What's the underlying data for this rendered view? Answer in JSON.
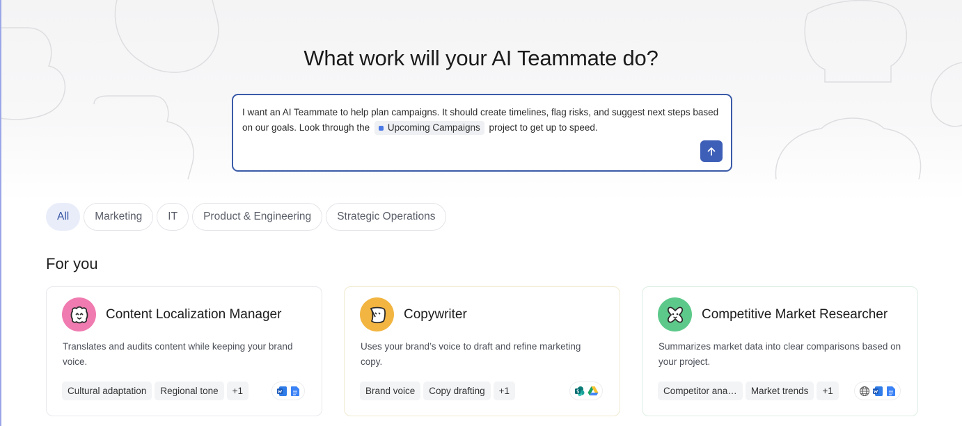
{
  "headline": "What work will your AI Teammate do?",
  "prompt": {
    "text_before": "I want an AI Teammate to help plan campaigns. It should create timelines, flag risks, and suggest next steps based on our goals. Look through the",
    "mention": "Upcoming Campaigns",
    "text_after": "project to get up to speed.",
    "send_icon": "arrow-up-icon"
  },
  "filters": [
    {
      "label": "All",
      "active": true
    },
    {
      "label": "Marketing",
      "active": false
    },
    {
      "label": "IT",
      "active": false
    },
    {
      "label": "Product & Engineering",
      "active": false
    },
    {
      "label": "Strategic Operations",
      "active": false
    }
  ],
  "section_title": "For you",
  "cards": [
    {
      "title": "Content Localization Manager",
      "description": "Translates and audits content while keeping your brand voice.",
      "tags": [
        "Cultural adaptation",
        "Regional tone",
        "+1"
      ],
      "avatar_color": "#f07bb0",
      "tools": [
        "word-icon",
        "docs-icon"
      ]
    },
    {
      "title": "Copywriter",
      "description": "Uses your brand’s voice to draft and refine marketing copy.",
      "tags": [
        "Brand voice",
        "Copy drafting",
        "+1"
      ],
      "avatar_color": "#f2b541",
      "tools": [
        "sharepoint-icon",
        "drive-icon"
      ]
    },
    {
      "title": "Competitive Market Researcher",
      "description": "Summarizes market data into clear comparisons based on your project.",
      "tags": [
        "Competitor ana…",
        "Market trends",
        "+1"
      ],
      "avatar_color": "#5cc98a",
      "tools": [
        "globe-icon",
        "word-icon",
        "docs-icon"
      ]
    }
  ],
  "colors": {
    "accent": "#3e5fb8",
    "chip_active_bg": "#e9edfa"
  }
}
